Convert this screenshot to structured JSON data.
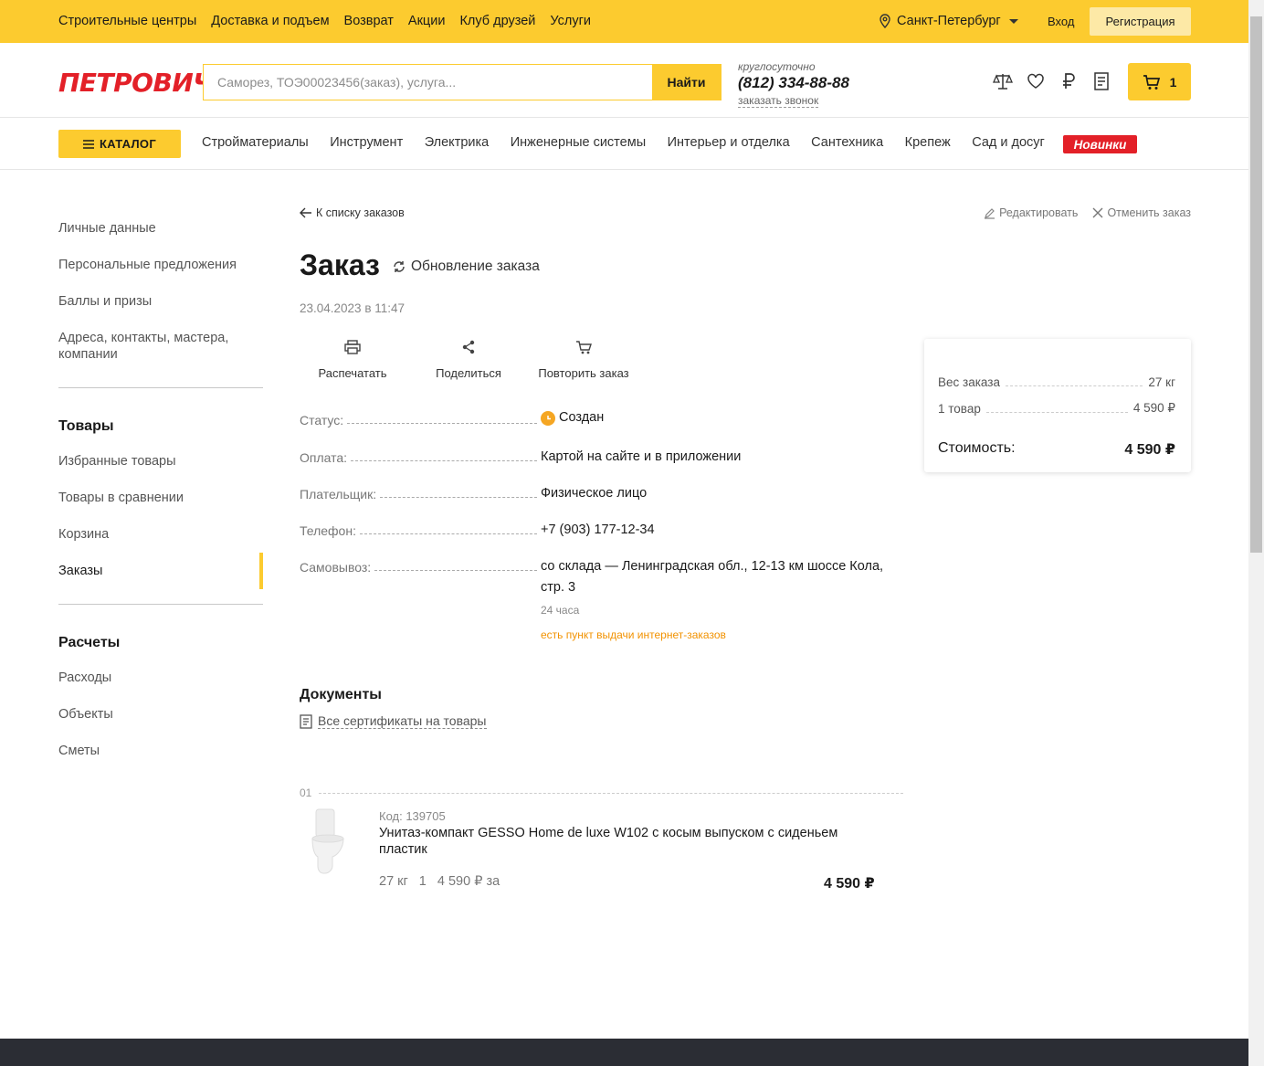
{
  "topbar": {
    "links": [
      "Строительные центры",
      "Доставка и подъем",
      "Возврат",
      "Акции",
      "Клуб друзей",
      "Услуги"
    ],
    "city": "Санкт-Петербург",
    "login": "Вход",
    "register": "Регистрация"
  },
  "header": {
    "logo": "ПЕТРОВИЧ",
    "search_placeholder": "Саморез, ТОЭ00023456(заказ), услуга...",
    "search_button": "Найти",
    "phone_label": "круглосуточно",
    "phone": "(812) 334-88-88",
    "call_link": "заказать звонок",
    "cart_count": "1"
  },
  "nav": {
    "catalog": "КАТАЛОГ",
    "links": [
      "Стройматериалы",
      "Инструмент",
      "Электрика",
      "Инженерные системы",
      "Интерьер и отделка",
      "Сантехника",
      "Крепеж",
      "Сад и досуг"
    ],
    "new_badge": "Новинки"
  },
  "sidebar": {
    "personal": [
      "Личные данные",
      "Персональные предложения",
      "Баллы и призы",
      "Адреса, контакты, мастера, компании"
    ],
    "goods_title": "Товары",
    "goods": [
      "Избранные товары",
      "Товары в сравнении",
      "Корзина",
      "Заказы"
    ],
    "calc_title": "Расчеты",
    "calc": [
      "Расходы",
      "Объекты",
      "Сметы"
    ]
  },
  "order": {
    "back_link": "К списку заказов",
    "edit": "Редактировать",
    "cancel": "Отменить заказ",
    "title": "Заказ",
    "update_status": "Обновление заказа",
    "date": "23.04.2023 в 11:47",
    "actions": [
      "Распечатать",
      "Поделиться",
      "Повторить заказ"
    ],
    "fields": {
      "status_label": "Статус:",
      "status_value": "Создан",
      "payment_label": "Оплата:",
      "payment_value": "Картой на сайте и в приложении",
      "payer_label": "Плательщик:",
      "payer_value": "Физическое лицо",
      "phone_label": "Телефон:",
      "phone_value": "+7 (903) 177-12-34",
      "pickup_label": "Самовывоз:",
      "pickup_value": "со склада — Ленинградская обл., 12-13 км шоссе Кола, стр. 3",
      "pickup_hours": "24 часа",
      "pickup_note": "есть пункт выдачи интернет-заказов"
    },
    "documents_title": "Документы",
    "documents_link": "Все сертификаты на товары",
    "item": {
      "index": "01",
      "code": "Код: 139705",
      "name": "Унитаз-компакт GESSO Home de luxe W102 с косым выпуском с сиденьем пластик",
      "weight": "27 кг",
      "qty": "1",
      "price": "4 590 ₽ за",
      "total": "4 590 ₽"
    }
  },
  "summary": {
    "weight_label": "Вес заказа",
    "weight_value": "27 кг",
    "items_label": "1 товар",
    "items_value": "4 590 ₽",
    "total_label": "Стоимость:",
    "total_value": "4 590 ₽"
  },
  "colors": {
    "brand_yellow": "#fccb2f",
    "brand_red": "#e32028",
    "status_orange": "#f5a623"
  }
}
